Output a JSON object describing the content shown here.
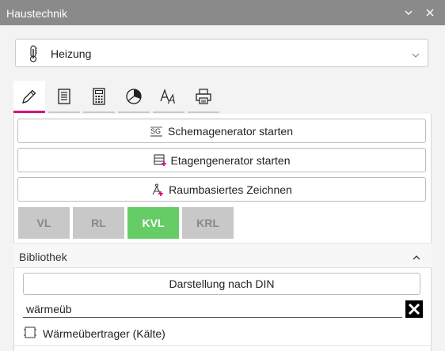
{
  "window": {
    "title": "Haustechnik",
    "controls": [
      "chevron-down-icon",
      "close-icon"
    ]
  },
  "dropdown": {
    "icon": "thermometer-icon",
    "selected": "Heizung"
  },
  "tabs": [
    {
      "icon": "pencil-icon",
      "active": true
    },
    {
      "icon": "list-icon",
      "active": false
    },
    {
      "icon": "calculator-icon",
      "active": false
    },
    {
      "icon": "pie-chart-icon",
      "active": false
    },
    {
      "icon": "font-style-icon",
      "active": false
    },
    {
      "icon": "printer-icon",
      "active": false
    }
  ],
  "actions": {
    "schema": {
      "label": "Schemagenerator starten",
      "icon": "schema-generator-icon"
    },
    "etage": {
      "label": "Etagengenerator starten",
      "icon": "floor-generator-icon"
    },
    "raum": {
      "label": "Raumbasiertes Zeichnen",
      "icon": "compass-draw-icon"
    }
  },
  "line_types": [
    {
      "label": "VL",
      "active": false
    },
    {
      "label": "RL",
      "active": false
    },
    {
      "label": "KVL",
      "active": true
    },
    {
      "label": "KRL",
      "active": false
    }
  ],
  "library": {
    "title": "Bibliothek",
    "din_button": "Darstellung nach DIN",
    "search_value": "wärmeüb",
    "results": [
      {
        "icon": "component-icon",
        "label": "Wärmeübertrager (Kälte)"
      }
    ]
  },
  "colors": {
    "titlebar": "#8a8a8a",
    "accent": "#d4127d",
    "active_line": "#66cc66",
    "inactive_line": "#c8c8c8"
  }
}
